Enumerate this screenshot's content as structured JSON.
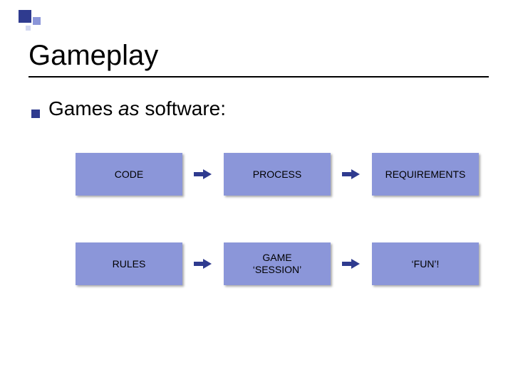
{
  "title": "Gameplay",
  "bullet": {
    "prefix": "Games ",
    "italic": "as",
    "suffix": " software:"
  },
  "rows": [
    {
      "a": "CODE",
      "b": "PROCESS",
      "c": "REQUIREMENTS"
    },
    {
      "a": "RULES",
      "b": "GAME\n‘SESSION’",
      "c": "‘FUN’!"
    }
  ],
  "colors": {
    "accent_dark": "#2f3b8f",
    "accent_light": "#8b96d9"
  }
}
